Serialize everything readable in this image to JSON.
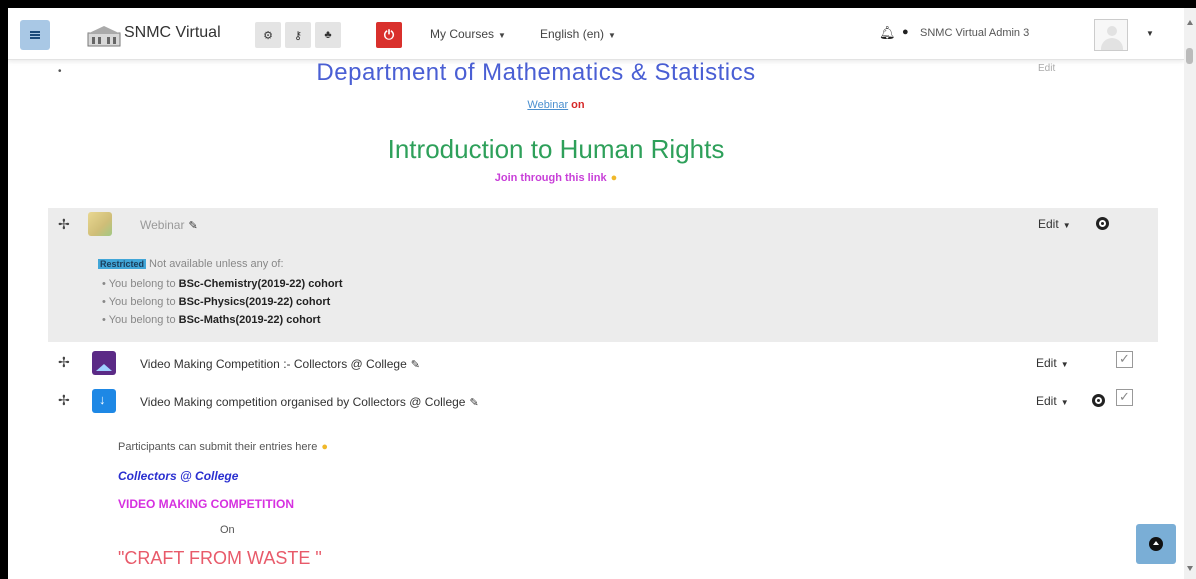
{
  "navbar": {
    "brand": "SNMC Virtual",
    "power_symbol": "⏻",
    "menu": [
      {
        "label": "My Courses"
      },
      {
        "label": "English (en)"
      }
    ],
    "user_name": "SNMC Virtual Admin 3"
  },
  "course": {
    "department_heading": "Department of Mathematics & Statistics",
    "top_edit_label": "Edit",
    "webinar_link": "Webinar",
    "webinar_on": "on",
    "intro_title": "Introduction to Human Rights",
    "join_text": "Join through this link"
  },
  "activities": [
    {
      "name": "Webinar",
      "icon": "webinar-icon",
      "edit_label": "Edit",
      "restriction": {
        "badge": "Restricted",
        "heading": "Not available unless any of:",
        "items": [
          {
            "prefix": "You belong to ",
            "cohort": "BSc-Chemistry(2019-22)",
            "suffix": " cohort"
          },
          {
            "prefix": "You belong to ",
            "cohort": "BSc-Physics(2019-22)",
            "suffix": " cohort"
          },
          {
            "prefix": "You belong to ",
            "cohort": "BSc-Maths(2019-22)",
            "suffix": " cohort"
          }
        ]
      }
    },
    {
      "name": "Video Making Competition :- Collectors @ College",
      "icon": "image-icon",
      "edit_label": "Edit"
    },
    {
      "name": "Video Making competition organised by Collectors @ College",
      "icon": "assignment-icon",
      "edit_label": "Edit"
    }
  ],
  "description": {
    "line1": "Participants can submit their entries here",
    "line2": "Collectors @ College",
    "line3": "VIDEO MAKING COMPETITION",
    "line4": "On",
    "line5": "\"CRAFT FROM WASTE \""
  },
  "colors": {
    "department": "#4a5fd4",
    "intro": "#2ea05a",
    "join": "#c83fd8",
    "power": "#d9302c",
    "hamburger": "#a9c8e5"
  }
}
